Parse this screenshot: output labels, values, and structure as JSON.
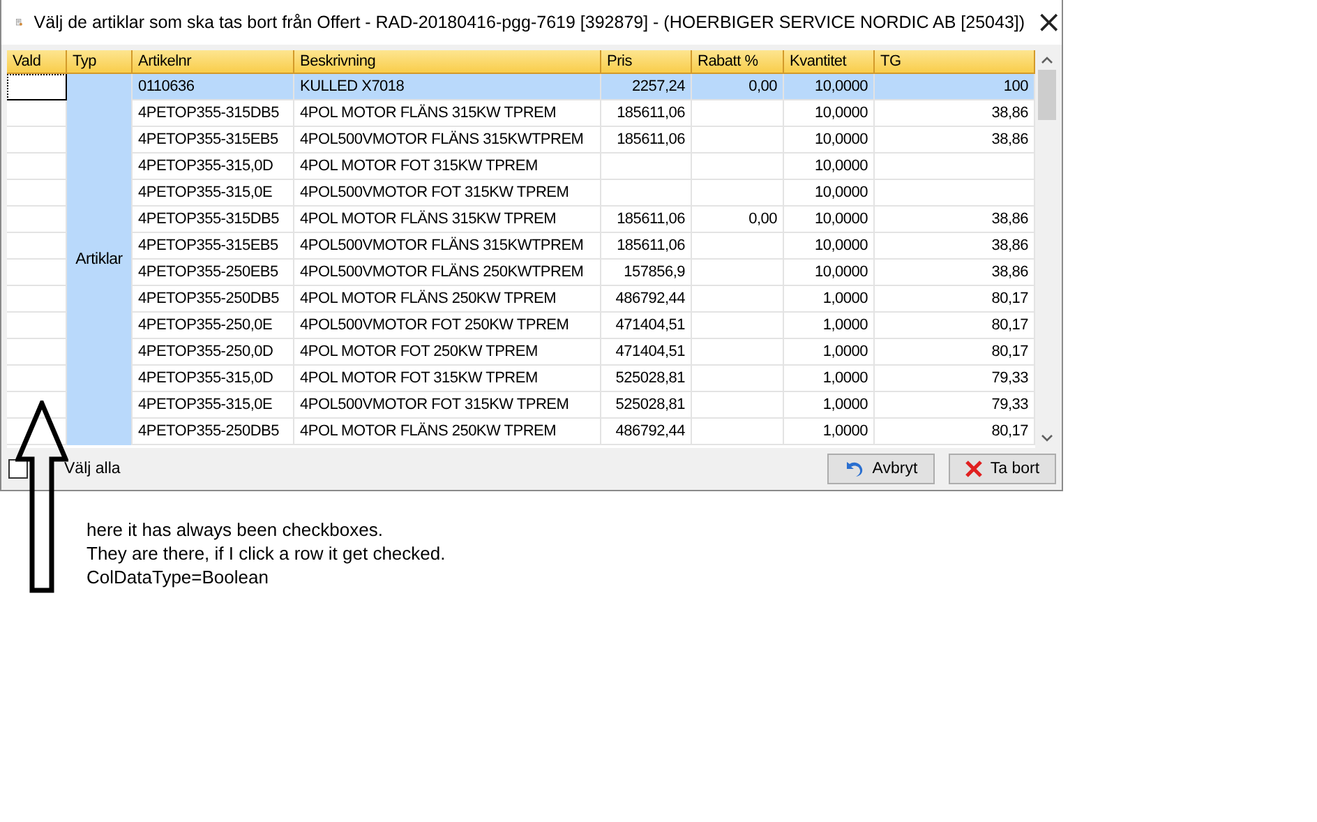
{
  "window": {
    "title": "Välj de artiklar som ska tas bort från Offert - RAD-20180416-pgg-7619 [392879] - (HOERBIGER SERVICE NORDIC AB [25043])",
    "close": "×"
  },
  "table": {
    "columns": [
      "Vald",
      "Typ",
      "Artikelnr",
      "Beskrivning",
      "Pris",
      "Rabatt %",
      "Kvantitet",
      "TG"
    ],
    "group": "Artiklar",
    "rows": [
      {
        "selected": true,
        "focused": true,
        "artikelnr": "0110636",
        "beskrivning": "KULLED X7018",
        "pris": "2257,24",
        "rabatt": "0,00",
        "kvantitet": "10,0000",
        "tg": "100"
      },
      {
        "selected": false,
        "focused": false,
        "artikelnr": "4PETOP355-315DB5",
        "beskrivning": "4POL MOTOR FLÄNS 315KW TPREM",
        "pris": "185611,06",
        "kvantitet": "10,0000",
        "tg": "38,86"
      },
      {
        "selected": false,
        "focused": false,
        "artikelnr": "4PETOP355-315EB5",
        "beskrivning": "4POL500VMOTOR FLÄNS 315KWTPREM",
        "pris": "185611,06",
        "kvantitet": "10,0000",
        "tg": "38,86"
      },
      {
        "selected": false,
        "focused": false,
        "artikelnr": "4PETOP355-315,0D",
        "beskrivning": "4POL MOTOR FOT 315KW TPREM",
        "kvantitet": "10,0000"
      },
      {
        "selected": false,
        "focused": false,
        "artikelnr": "4PETOP355-315,0E",
        "beskrivning": "4POL500VMOTOR FOT 315KW TPREM",
        "kvantitet": "10,0000"
      },
      {
        "selected": false,
        "focused": false,
        "artikelnr": "4PETOP355-315DB5",
        "beskrivning": "4POL MOTOR FLÄNS 315KW TPREM",
        "pris": "185611,06",
        "rabatt": "0,00",
        "kvantitet": "10,0000",
        "tg": "38,86"
      },
      {
        "selected": false,
        "focused": false,
        "artikelnr": "4PETOP355-315EB5",
        "beskrivning": "4POL500VMOTOR FLÄNS 315KWTPREM",
        "pris": "185611,06",
        "kvantitet": "10,0000",
        "tg": "38,86"
      },
      {
        "selected": false,
        "focused": false,
        "artikelnr": "4PETOP355-250EB5",
        "beskrivning": "4POL500VMOTOR FLÄNS 250KWTPREM",
        "pris": "157856,9",
        "kvantitet": "10,0000",
        "tg": "38,86"
      },
      {
        "selected": false,
        "focused": false,
        "artikelnr": "4PETOP355-250DB5",
        "beskrivning": "4POL MOTOR FLÄNS 250KW TPREM",
        "pris": "486792,44",
        "kvantitet": "1,0000",
        "tg": "80,17"
      },
      {
        "selected": false,
        "focused": false,
        "artikelnr": "4PETOP355-250,0E",
        "beskrivning": "4POL500VMOTOR FOT 250KW TPREM",
        "pris": "471404,51",
        "kvantitet": "1,0000",
        "tg": "80,17"
      },
      {
        "selected": false,
        "focused": false,
        "artikelnr": "4PETOP355-250,0D",
        "beskrivning": "4POL MOTOR FOT 250KW TPREM",
        "pris": "471404,51",
        "kvantitet": "1,0000",
        "tg": "80,17"
      },
      {
        "selected": false,
        "focused": false,
        "artikelnr": "4PETOP355-315,0D",
        "beskrivning": "4POL MOTOR FOT 315KW TPREM",
        "pris": "525028,81",
        "kvantitet": "1,0000",
        "tg": "79,33"
      },
      {
        "selected": false,
        "focused": false,
        "artikelnr": "4PETOP355-315,0E",
        "beskrivning": "4POL500VMOTOR FOT 315KW TPREM",
        "pris": "525028,81",
        "kvantitet": "1,0000",
        "tg": "79,33"
      },
      {
        "selected": false,
        "focused": false,
        "artikelnr": "4PETOP355-250DB5",
        "beskrivning": "4POL MOTOR FLÄNS 250KW TPREM",
        "pris": "486792,44",
        "kvantitet": "1,0000",
        "tg": "80,17"
      }
    ]
  },
  "select_all": {
    "label": "Välj alla",
    "checked": false
  },
  "buttons": [
    {
      "kind": "cancel",
      "label": "Avbryt"
    },
    {
      "kind": "delete",
      "label": "Ta bort"
    }
  ],
  "annotation": [
    "here it has always been checkboxes.",
    "They are there, if I click a row it get checked.",
    "ColDataType=Boolean"
  ]
}
